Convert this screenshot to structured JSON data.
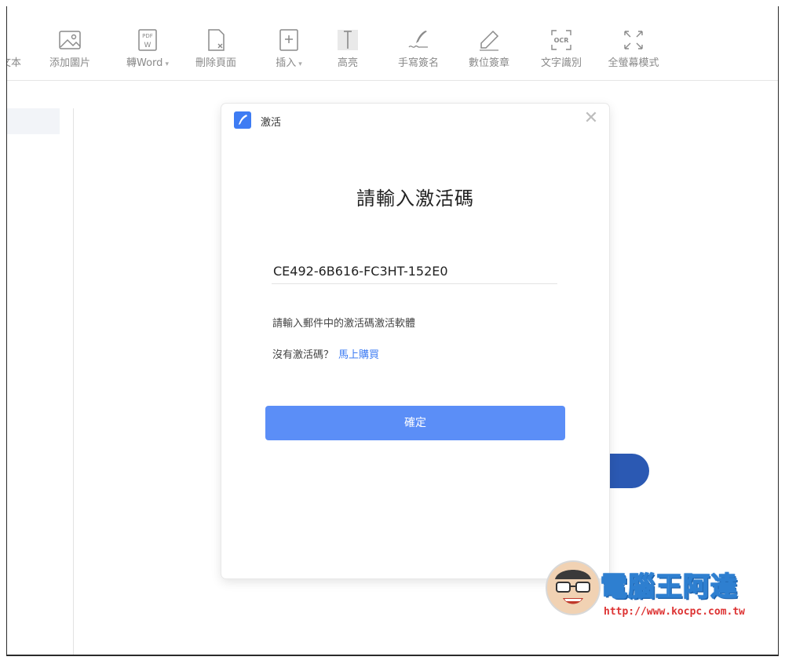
{
  "toolbar": {
    "items": [
      {
        "label": "文本",
        "icon": "text-icon"
      },
      {
        "label": "添加圖片",
        "icon": "image-icon"
      },
      {
        "label": "轉Word",
        "icon": "pdf-to-word-icon",
        "caret": "▾"
      },
      {
        "label": "刪除頁面",
        "icon": "delete-page-icon"
      },
      {
        "label": "插入",
        "icon": "insert-page-icon",
        "caret": "▾"
      },
      {
        "label": "高亮",
        "icon": "highlight-icon"
      },
      {
        "label": "手寫簽名",
        "icon": "signature-icon"
      },
      {
        "label": "數位簽章",
        "icon": "pen-icon"
      },
      {
        "label": "文字識別",
        "icon": "ocr-icon"
      },
      {
        "label": "全螢幕模式",
        "icon": "fullscreen-icon"
      }
    ],
    "pdf_badge": "PDF",
    "word_badge": "W",
    "ocr_badge": "OCR"
  },
  "dialog": {
    "title": "激活",
    "close_glyph": "✕",
    "heading": "請輸入激活碼",
    "code_value": "CE492-6B616-FC3HT-152E0",
    "hint": "請輸入郵件中的激活碼激活軟體",
    "no_code_text": "沒有激活碼？",
    "buy_link": "馬上購買",
    "confirm_button": "確定"
  },
  "watermark": {
    "title": "電腦王阿達",
    "url": "http://www.kocpc.com.tw"
  },
  "colors": {
    "accent": "#5b8ef7",
    "link": "#3e7cf3",
    "bg_button": "#2b59b3"
  }
}
